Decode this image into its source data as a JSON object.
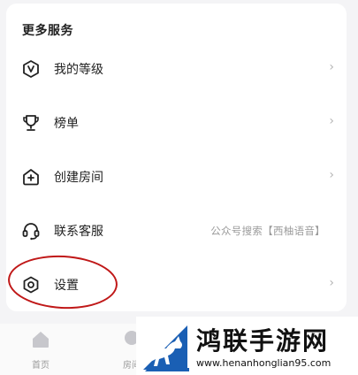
{
  "section": {
    "title": "更多服务"
  },
  "menu": {
    "items": [
      {
        "label": "我的等级",
        "icon": "level-badge-icon",
        "chevron": "›"
      },
      {
        "label": "榜单",
        "icon": "trophy-icon",
        "chevron": "›"
      },
      {
        "label": "创建房间",
        "icon": "add-room-icon",
        "chevron": "›"
      },
      {
        "label": "联系客服",
        "icon": "headset-icon",
        "hint": "公众号搜索【西柚语音】"
      },
      {
        "label": "设置",
        "icon": "settings-icon",
        "chevron": "›"
      }
    ]
  },
  "tabbar": {
    "tabs": [
      {
        "label": "首页",
        "icon": "home-icon"
      },
      {
        "label": "房间",
        "icon": "room-icon"
      }
    ]
  },
  "watermark": {
    "title": "鸿联手游网",
    "url": "www.henanhonglian95.com"
  },
  "colors": {
    "annotation": "#c01818",
    "watermark_blue": "#1a5fb4"
  }
}
